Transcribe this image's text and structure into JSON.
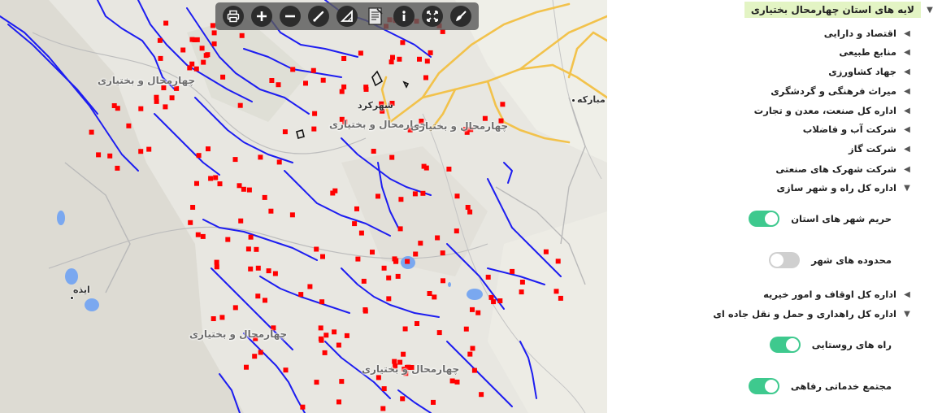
{
  "toolbar": {
    "tools": [
      {
        "name": "print-icon"
      },
      {
        "name": "zoom-in-icon"
      },
      {
        "name": "zoom-out-icon"
      },
      {
        "name": "measure-line-icon"
      },
      {
        "name": "measure-area-icon"
      },
      {
        "name": "report-icon"
      },
      {
        "name": "info-icon"
      },
      {
        "name": "full-extent-icon"
      },
      {
        "name": "clear-icon"
      }
    ]
  },
  "map": {
    "labels": {
      "region_1": "چهارمحال و بختیاری",
      "region_2": "چهارمحال و بختیاری",
      "region_3": "چهارمحال و بختیاری",
      "region_4": "چهارمحال و بختیاری",
      "region_5": "چهارمحال و بختیاری"
    },
    "cities": {
      "shahrekord": "شهرکرد",
      "mobarakeh": "مبارکه",
      "izeh": "ایذه"
    },
    "colors": {
      "river": "#1d1df0",
      "point": "#ff0000",
      "road": "#f2c24b",
      "water": "#7aa8f0",
      "background": "#e8e7e1"
    }
  },
  "panel": {
    "root": {
      "label": "لایه های استان چهارمحال بختیاری",
      "expanded": true
    },
    "groups": [
      {
        "label": "اقتصاد و دارایی",
        "expanded": false
      },
      {
        "label": "منابع طبیعی",
        "expanded": false
      },
      {
        "label": "جهاد کشاورزی",
        "expanded": false
      },
      {
        "label": "میراث فرهنگی و گردشگری",
        "expanded": false
      },
      {
        "label": "اداره کل صنعت، معدن و تجارت",
        "expanded": false
      },
      {
        "label": "شرکت آب و فاضلاب",
        "expanded": false
      },
      {
        "label": "شرکت گاز",
        "expanded": false
      },
      {
        "label": "شرکت شهرک های صنعتی",
        "expanded": false
      },
      {
        "label": "اداره کل راه و شهر سازی",
        "expanded": true
      }
    ],
    "road_layers": [
      {
        "label": "حریم شهر های استان",
        "on": true
      },
      {
        "label": "محدوده های شهر",
        "on": false
      }
    ],
    "more_groups": [
      {
        "label": "اداره کل اوقاف و امور خیریه",
        "expanded": false
      },
      {
        "label": "اداره کل راهداری و حمل و نقل جاده ای",
        "expanded": true
      }
    ],
    "transport_layers": [
      {
        "label": "راه های روستایی",
        "on": true
      },
      {
        "label": "مجتمع خدماتی رفاهی",
        "on": true
      }
    ]
  }
}
